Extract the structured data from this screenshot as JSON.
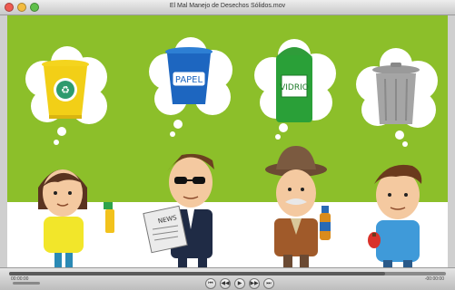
{
  "window": {
    "title": "El Mal Manejo de Desechos Sólidos.mov"
  },
  "bins": {
    "papel_label": "PAPEL",
    "vidrio_label": "VIDRIO"
  },
  "newspaper": {
    "headline": "NEWS"
  },
  "player": {
    "progress": 0.86,
    "current_time": "00:00:00",
    "remaining_time": "-00:00:00",
    "buttons": {
      "rewind": "⏮",
      "back": "◀◀",
      "play": "▶",
      "forward": "▶▶",
      "end": "⏭"
    }
  },
  "colors": {
    "background_green": "#8cbf2a",
    "floor": "#ffffff",
    "cloud": "#ffffff"
  }
}
